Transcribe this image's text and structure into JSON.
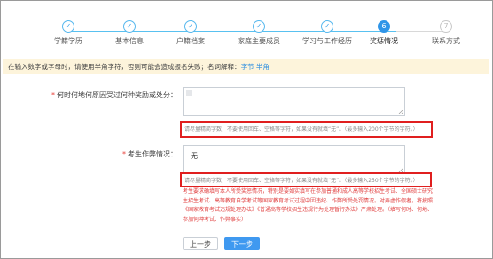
{
  "steps": [
    {
      "label": "学籍学历",
      "symbol": "✓",
      "state": "done"
    },
    {
      "label": "基本信息",
      "symbol": "✓",
      "state": "done"
    },
    {
      "label": "户籍档案",
      "symbol": "✓",
      "state": "done"
    },
    {
      "label": "家庭主要成员",
      "symbol": "✓",
      "state": "done"
    },
    {
      "label": "学习与工作经历",
      "symbol": "✓",
      "state": "done"
    },
    {
      "label": "奖惩情况",
      "symbol": "6",
      "state": "active"
    },
    {
      "label": "联系方式",
      "symbol": "7",
      "state": "pending"
    }
  ],
  "notice": {
    "text": "在输入数字或字母时，请使用半角字符，否则可能会造成报名失败；名词解释：",
    "link1": "字节",
    "link2": "半角",
    "sep": " "
  },
  "award": {
    "label": "何时何地何原因受过何种奖励或处分：",
    "value": "",
    "hint": "请尽量精简字数，不要使用回车、空格等字符，如果没有就填“无”。（最多输入200个字节的字符。）"
  },
  "cheat": {
    "label": "考生作弊情况：",
    "value": "无",
    "hint": "请尽量精简字数，不要使用回车、空格等字符，如果没有就填“无”。（最多输入250个字节的字符。）",
    "warning": "考生要求确填写本人所受奖惩情况，特别是要如实填写在参加普通和成人高等学校招生考试、全国硕士研究生招生考试、高等教育自学考试等国家教育考试过程中因违纪、作弊所受处罚情况。对弄虚作假者，将按照《国家教育考试违规处理办法》《普通高等学校招生违规行为处理暂行办法》严肃处理。（填写何时、何地、参加何种考试、作弊事实）"
  },
  "buttons": {
    "prev": "上一步",
    "next": "下一步"
  },
  "colors": {
    "accent": "#3f99f0",
    "highlight": "#e01f1f",
    "notice_bg": "#fdf4db"
  }
}
